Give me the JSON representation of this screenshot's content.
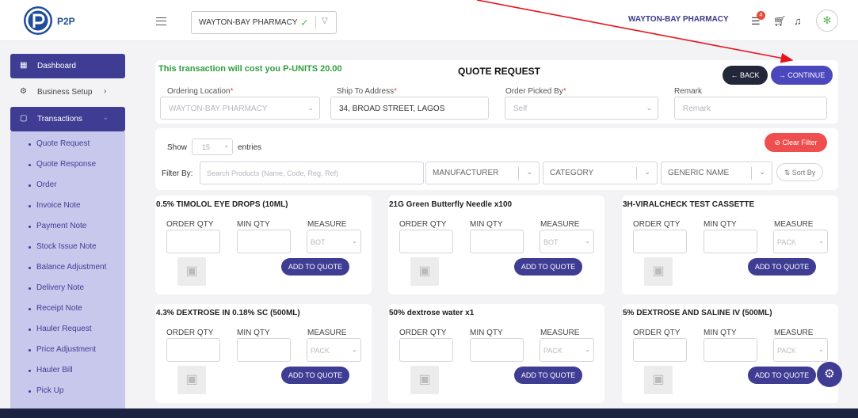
{
  "header": {
    "logo_text": "P2P",
    "location_selected": "WAYTON-BAY PHARMACY",
    "pharmacy_name": "WAYTON-BAY PHARMACY",
    "cart_badge": "4"
  },
  "sidebar": {
    "items": [
      {
        "label": "Dashboard"
      },
      {
        "label": "Business Setup"
      },
      {
        "label": "Transactions"
      }
    ],
    "sub_items": [
      "Quote Request",
      "Quote Response",
      "Order",
      "Invoice Note",
      "Payment Note",
      "Stock Issue Note",
      "Balance Adjustment",
      "Delivery Note",
      "Receipt Note",
      "Hauler Request",
      "Price Adjustment",
      "Hauler Bill",
      "Pick Up"
    ]
  },
  "quote": {
    "cost_text": "This transaction will cost you P-UNITS 20.00",
    "title": "QUOTE REQUEST",
    "back_label": "BACK",
    "continue_label": "CONTINUE",
    "ordering_location_label": "Ordering Location",
    "ordering_location_value": "WAYTON-BAY PHARMACY",
    "ship_to_label": "Ship To Address",
    "ship_to_value": "34, BROAD STREET, LAGOS",
    "picked_by_label": "Order Picked By",
    "picked_by_placeholder": "Self",
    "remark_label": "Remark",
    "remark_placeholder": "Remark",
    "required_mark": "*"
  },
  "filters": {
    "show_label": "Show",
    "show_value": "15",
    "entries_label": "entries",
    "clear_label": "Clear Filter",
    "filter_by_label": "Filter By:",
    "search_placeholder": "Search Products (Name, Code, Reg. Ref)",
    "manufacturer": "MANUFACTURER",
    "category": "CATEGORY",
    "generic_name": "GENERIC NAME",
    "sort_by": "Sort By"
  },
  "product_labels": {
    "order_qty": "ORDER QTY",
    "min_qty": "MIN QTY",
    "measure": "MEASURE",
    "add_to_quote": "ADD TO QUOTE"
  },
  "products": [
    {
      "name": "0.5% TIMOLOL EYE DROPS (10ML)",
      "measure": "BOT"
    },
    {
      "name": "21G Green Butterfly Needle x100",
      "measure": "BOT"
    },
    {
      "name": "3H-VIRALCHECK TEST CASSETTE",
      "measure": "PACK"
    },
    {
      "name": "4.3% DEXTROSE IN 0.18% SC (500ML)",
      "measure": "PACK"
    },
    {
      "name": "50% dextrose water x1",
      "measure": "PACK"
    },
    {
      "name": "5% DEXTROSE AND SALINE IV (500ML)",
      "measure": "PACK"
    }
  ],
  "colors": {
    "primary": "#3f3c94",
    "accent": "#4b47bd",
    "danger": "#ef4e4e",
    "success": "#2e9e3e"
  }
}
